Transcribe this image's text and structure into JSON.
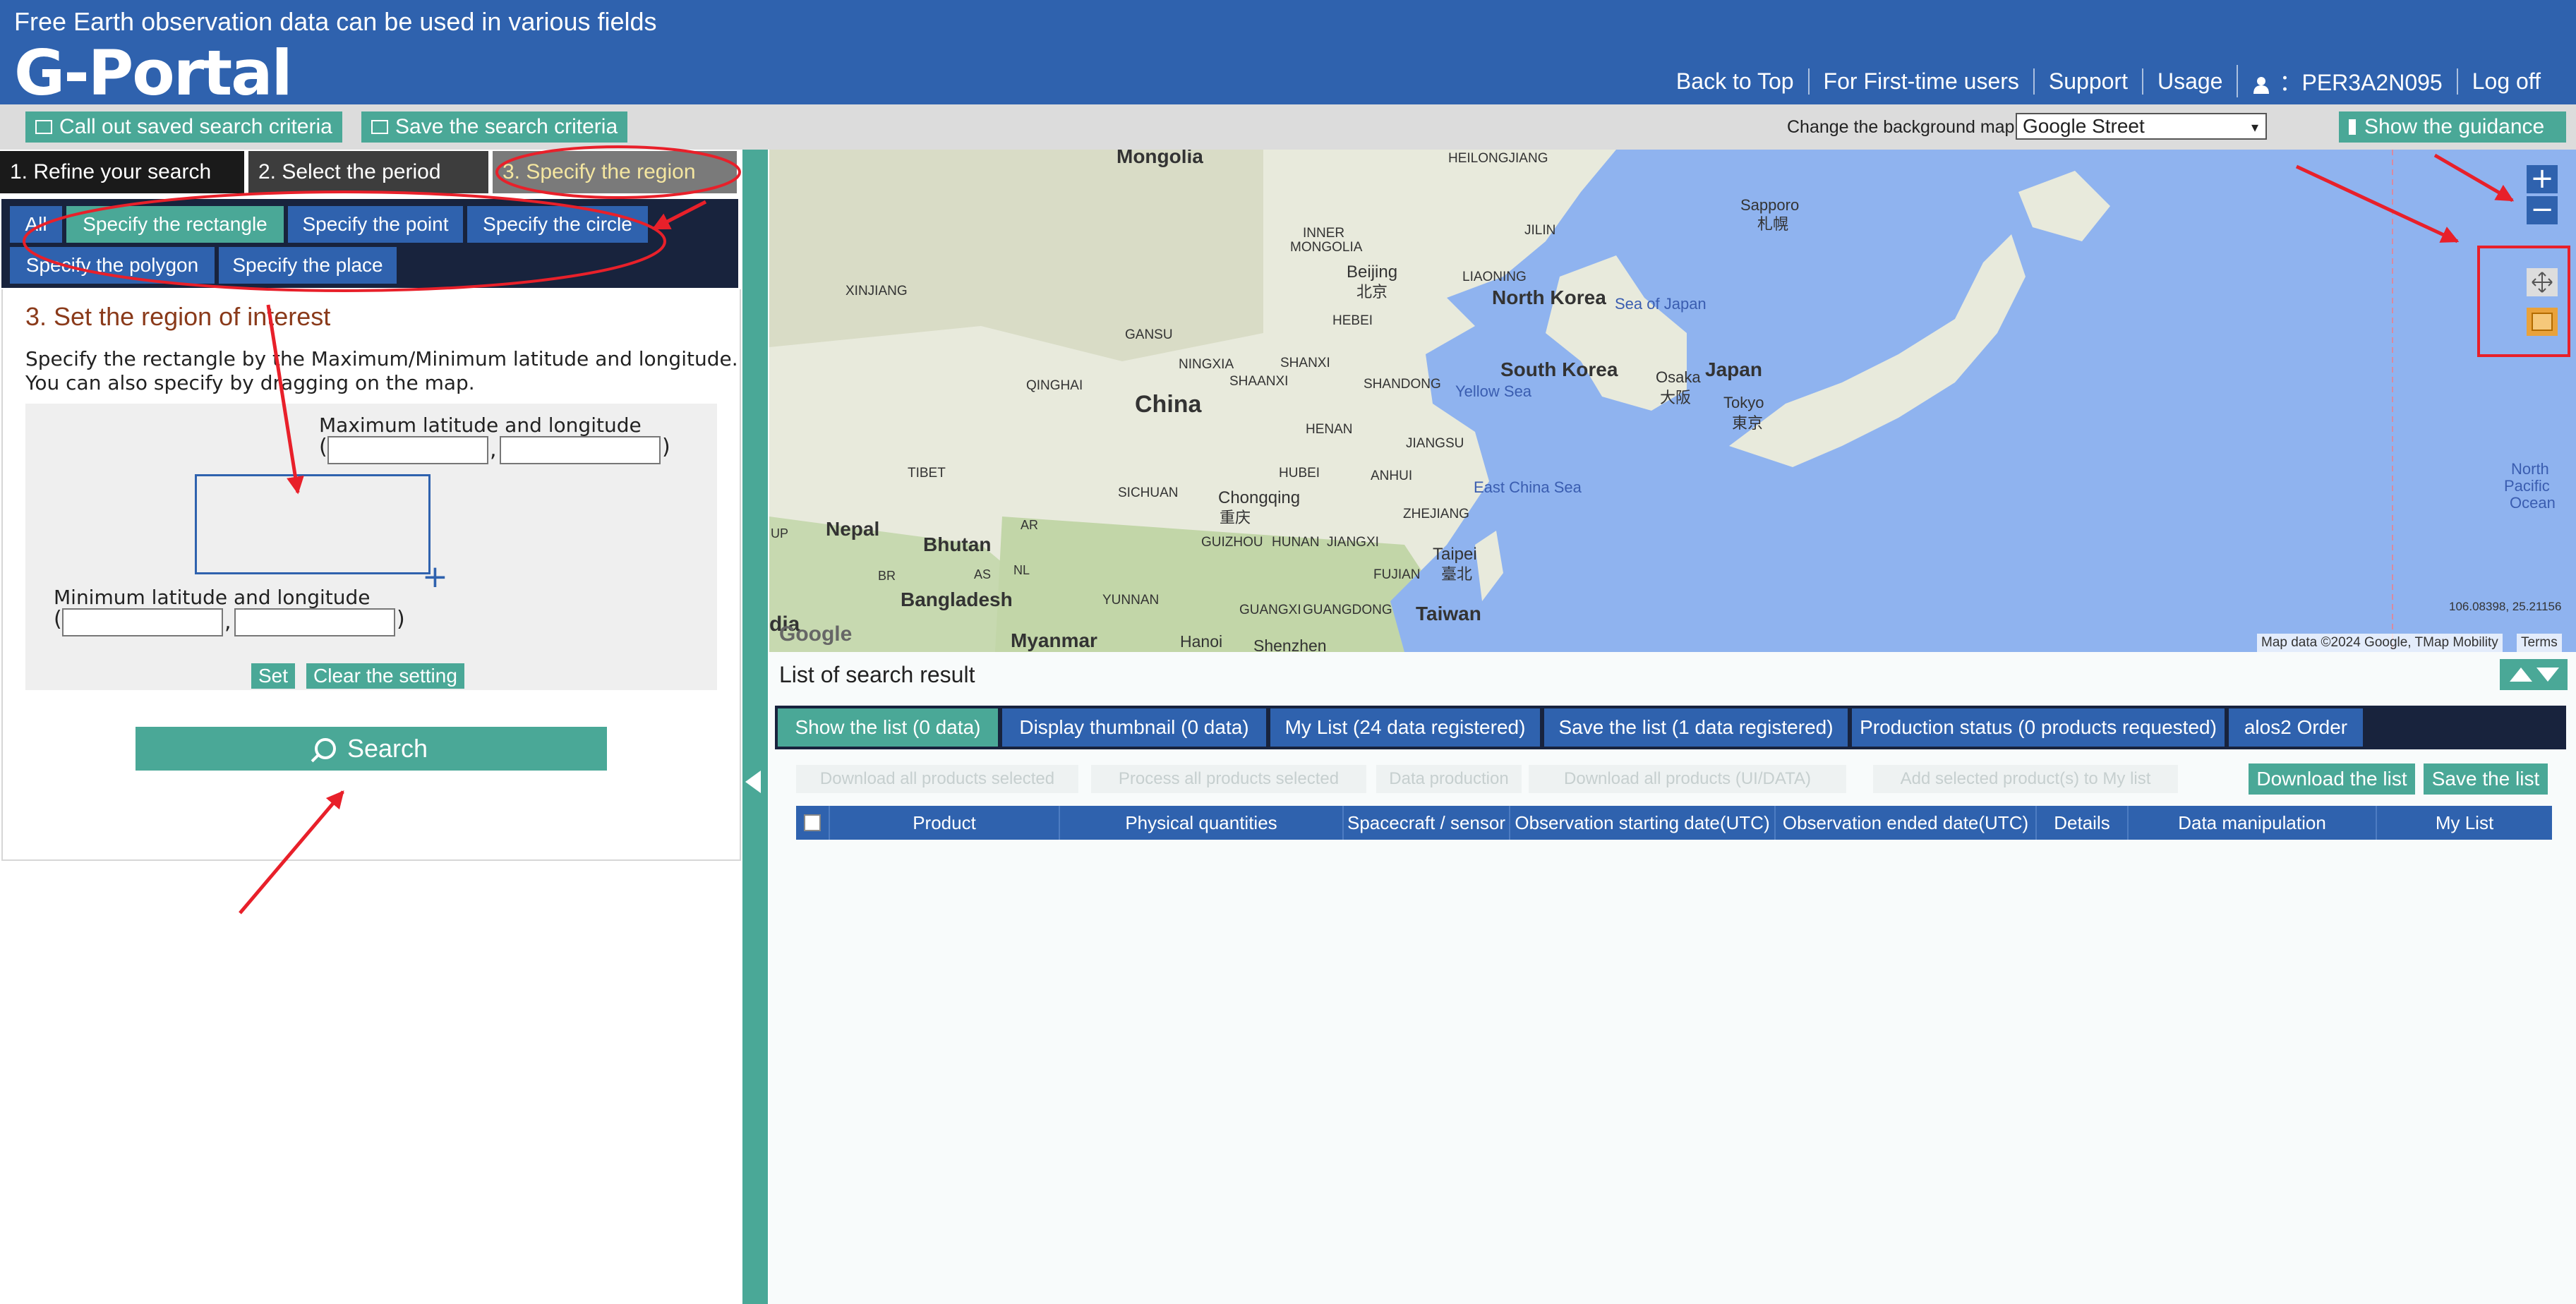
{
  "header": {
    "tagline": "Free Earth observation data can be used in various fields",
    "logo": "G-Portal",
    "nav": {
      "back_to_top": "Back to Top",
      "first_time": "For First-time users",
      "support": "Support",
      "usage": "Usage",
      "user": "：PER3A2N095",
      "logoff": "Log off"
    }
  },
  "toolbar": {
    "call_out": "Call out saved search criteria",
    "save_criteria": "Save the search criteria",
    "bgmap_label": "Change the background map",
    "bgmap_value": "Google Street",
    "guidance": "Show the guidance"
  },
  "steps": {
    "s1": "1. Refine your search",
    "s2": "2. Select the period",
    "s3": "3. Specify the region"
  },
  "subtabs": {
    "all": "All",
    "rectangle": "Specify the rectangle",
    "point": "Specify the point",
    "circle": "Specify the circle",
    "polygon": "Specify the polygon",
    "place": "Specify the place"
  },
  "region": {
    "title": "3. Set the region of interest",
    "desc1": "Specify the rectangle by the Maximum/Minimum latitude and longitude.",
    "desc2": "You can also specify by dragging on the map.",
    "max_label": "Maximum latitude and longitude",
    "min_label": "Minimum latitude and longitude",
    "set": "Set",
    "clear": "Clear the setting"
  },
  "search_button": "Search",
  "map": {
    "labels": {
      "mongolia": "Mongolia",
      "heilongjiang": "HEILONGJIANG",
      "jilin": "JILIN",
      "liaoning": "LIAONING",
      "inner_mongolia_1": "INNER",
      "inner_mongolia_2": "MONGOLIA",
      "xinjiang": "XINJIANG",
      "beijing": "Beijing",
      "beijing_zh": "北京",
      "hebei": "HEBEI",
      "gansu": "GANSU",
      "ningxia": "NINGXIA",
      "shanxi": "SHANXI",
      "shandong": "SHANDONG",
      "qinghai": "QINGHAI",
      "shaanxi": "SHAANXI",
      "china": "China",
      "henan": "HENAN",
      "jiangsu": "JIANGSU",
      "tibet": "TIBET",
      "sichuan": "SICHUAN",
      "chongqing": "Chongqing",
      "chongqing_zh": "重庆",
      "hubei": "HUBEI",
      "anhui": "ANHUI",
      "zhejiang": "ZHEJIANG",
      "guizhou": "GUIZHOU",
      "hunan": "HUNAN",
      "jiangxi": "JIANGXI",
      "fujian": "FUJIAN",
      "yunnan": "YUNNAN",
      "guangxi": "GUANGXI",
      "guangdong": "GUANGDONG",
      "nepal": "Nepal",
      "bhutan": "Bhutan",
      "bangladesh": "Bangladesh",
      "myanmar": "Myanmar",
      "hanoi": "Hanoi",
      "shenzhen": "Shenzhen",
      "taipei": "Taipei",
      "taipei_zh": "臺北",
      "taiwan": "Taiwan",
      "north_korea": "North Korea",
      "south_korea": "South Korea",
      "sea_of_japan": "Sea of Japan",
      "yellow_sea": "Yellow Sea",
      "east_china_sea": "East China Sea",
      "japan": "Japan",
      "osaka": "Osaka",
      "osaka_zh": "大阪",
      "tokyo": "Tokyo",
      "tokyo_zh": "東京",
      "sapporo": "Sapporo",
      "sapporo_zh": "札幌",
      "north_pacific_1": "North",
      "north_pacific_2": "Pacific",
      "north_pacific_3": "Ocean",
      "india": "dia",
      "up": "UP",
      "br": "BR",
      "as": "AS",
      "nl": "NL",
      "ar": "AR",
      "google": "Google"
    },
    "coords": "106.08398, 25.21156",
    "attribution": "Map data ©2024 Google, TMap Mobility",
    "terms": "Terms",
    "zoom_in": "+",
    "zoom_out": "−"
  },
  "results": {
    "title": "List of search result",
    "tabs": {
      "list": "Show the list (0 data)",
      "thumb": "Display thumbnail (0 data)",
      "mylist": "My List (24 data registered)",
      "savelist": "Save the list (1 data registered)",
      "production": "Production status (0 products requested)",
      "alos2": "alos2 Order"
    },
    "ghost": {
      "g1": "Download all products selected",
      "g2": "Process all products selected",
      "g3": "Data production",
      "g4": "Download all products (UI/DATA)",
      "g5": "Add selected product(s) to My list"
    },
    "download_list": "Download the list",
    "save_list": "Save the list",
    "columns": {
      "product": "Product",
      "physical": "Physical quantities",
      "spacecraft": "Spacecraft / sensor",
      "obs_start": "Observation starting date(UTC)",
      "obs_end": "Observation ended date(UTC)",
      "details": "Details",
      "manip": "Data manipulation",
      "mylist": "My List"
    }
  },
  "colors": {
    "header_blue": "#2f62ae",
    "teal": "#4aa897",
    "navy": "#18233d",
    "sea": "#8fb3ef",
    "annotation_red": "#e8202a"
  }
}
